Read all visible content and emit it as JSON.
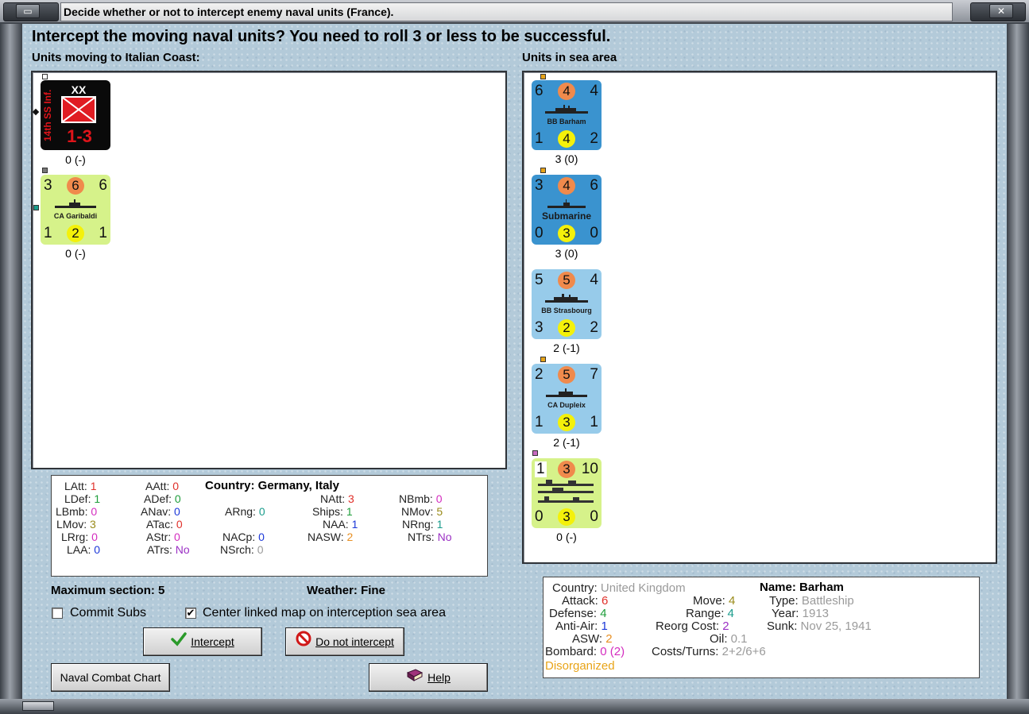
{
  "window": {
    "title": "Decide whether or not to intercept enemy naval units (France).",
    "menu_glyph": "▭",
    "close_glyph": "✕"
  },
  "prompt": "Intercept the moving naval units?  You need to roll 3 or less to be successful.",
  "left_panel": {
    "label": "Units moving to Italian Coast:",
    "units": [
      {
        "kind": "land",
        "side_text": "14th SS Inf.",
        "size": "XX",
        "strength": "1-3",
        "caption": "0 (-)"
      },
      {
        "kind": "naval",
        "tl": "3",
        "top": "6",
        "tr": "6",
        "name": "CA Garibaldi",
        "bl": "1",
        "bot": "2",
        "br": "1",
        "caption": "0 (-)"
      }
    ]
  },
  "right_panel": {
    "label": "Units in sea area",
    "units": [
      {
        "tl": "6",
        "top": "4",
        "tr": "4",
        "name": "BB Barham",
        "bl": "1",
        "bot": "4",
        "br": "2",
        "caption": "3 (0)"
      },
      {
        "tl": "3",
        "top": "4",
        "tr": "6",
        "name": "Submarine",
        "bl": "0",
        "bot": "3",
        "br": "0",
        "caption": "3 (0)"
      },
      {
        "tl": "5",
        "top": "5",
        "tr": "4",
        "name": "BB Strasbourg",
        "bl": "3",
        "bot": "2",
        "br": "2",
        "caption": "2 (-1)"
      },
      {
        "tl": "2",
        "top": "5",
        "tr": "7",
        "name": "CA Dupleix",
        "bl": "1",
        "bot": "3",
        "br": "1",
        "caption": "2 (-1)"
      },
      {
        "tl": "1",
        "top": "3",
        "tr": "10",
        "name": "",
        "bl": "0",
        "bot": "3",
        "br": "0",
        "caption": "0 (-)"
      }
    ]
  },
  "summary": {
    "country_label": "Country: Germany, Italy",
    "LAtt": "LAtt:",
    "LAtt_v": "1",
    "LDef": "LDef:",
    "LDef_v": "1",
    "LBmb": "LBmb:",
    "LBmb_v": "0",
    "LMov": "LMov:",
    "LMov_v": "3",
    "LRrg": "LRrg:",
    "LRrg_v": "0",
    "LAA": "LAA:",
    "LAA_v": "0",
    "AAtt": "AAtt:",
    "AAtt_v": "0",
    "ADef": "ADef:",
    "ADef_v": "0",
    "ANav": "ANav:",
    "ANav_v": "0",
    "ATac": "ATac:",
    "ATac_v": "0",
    "AStr": "AStr:",
    "AStr_v": "0",
    "ATrs": "ATrs:",
    "ATrs_v": "No",
    "ARng": "ARng:",
    "ARng_v": "0",
    "NACp": "NACp:",
    "NACp_v": "0",
    "NSrch": "NSrch:",
    "NSrch_v": "0",
    "NAtt": "NAtt:",
    "NAtt_v": "3",
    "Ships": "Ships:",
    "Ships_v": "1",
    "NAA": "NAA:",
    "NAA_v": "1",
    "NASW": "NASW:",
    "NASW_v": "2",
    "NBmb": "NBmb:",
    "NBmb_v": "0",
    "NMov": "NMov:",
    "NMov_v": "5",
    "NRng": "NRng:",
    "NRng_v": "1",
    "NTrs": "NTrs:",
    "NTrs_v": "No"
  },
  "max_section": "Maximum section: 5",
  "weather": "Weather:  Fine",
  "options": {
    "commit_subs": {
      "label": "Commit Subs",
      "checked": ""
    },
    "center_map": {
      "label": "Center linked map on interception sea area",
      "checked": "✔"
    }
  },
  "buttons": {
    "intercept": "Intercept",
    "do_not_intercept": "Do not intercept",
    "naval_combat_chart": "Naval Combat Chart",
    "help": "Help"
  },
  "details": {
    "country_k": "Country:",
    "country_v": "United Kingdom",
    "attack_k": "Attack:",
    "attack_v": "6",
    "defense_k": "Defense:",
    "defense_v": "4",
    "antiair_k": "Anti-Air:",
    "antiair_v": "1",
    "asw_k": "ASW:",
    "asw_v": "2",
    "bombard_k": "Bombard:",
    "bombard_v": "0",
    "bombard_v2": "(2)",
    "move_k": "Move:",
    "move_v": "4",
    "range_k": "Range:",
    "range_v": "4",
    "reorg_k": "Reorg Cost:",
    "reorg_v": "2",
    "oil_k": "Oil:",
    "oil_v": "0.1",
    "costs_k": "Costs/Turns:",
    "costs_v": "2+2/6+6",
    "name_k": "Name:",
    "name_v": "Barham",
    "type_k": "Type:",
    "type_v": "Battleship",
    "year_k": "Year:",
    "year_v": "1913",
    "sunk_k": "Sunk:",
    "sunk_v": "Nov 25, 1941",
    "status": "Disorganized"
  }
}
